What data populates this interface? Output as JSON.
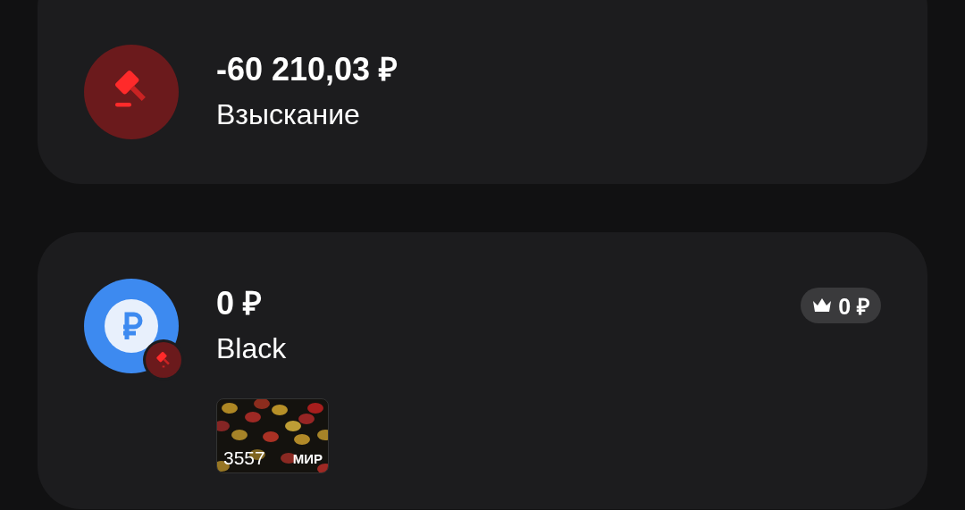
{
  "accounts": [
    {
      "kind": "debt",
      "amount": "-60 210,03 ₽",
      "label": "Взыскание"
    },
    {
      "kind": "rub",
      "amount": "0 ₽",
      "label": "Black",
      "cashback": "0 ₽",
      "card": {
        "number": "3557",
        "system": "МИР"
      }
    }
  ]
}
